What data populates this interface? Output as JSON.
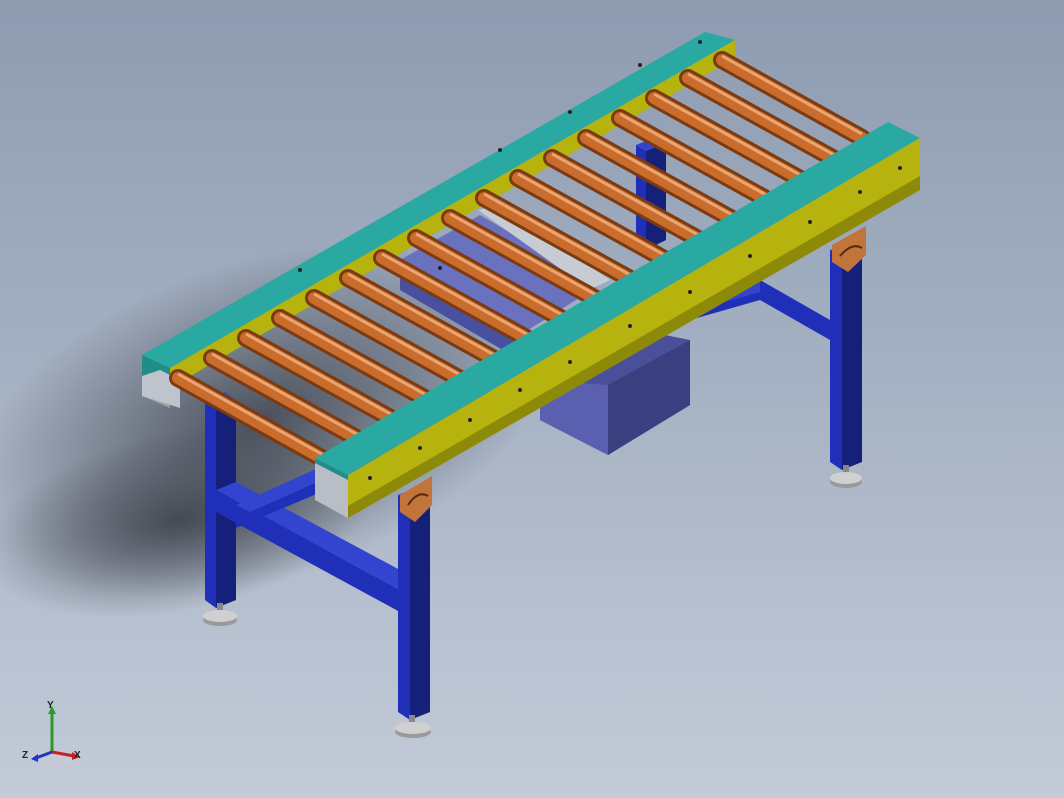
{
  "view": {
    "model_name": "roller conveyor"
  },
  "triad": {
    "x_label": "X",
    "y_label": "Y",
    "z_label": "Z"
  },
  "colors": {
    "frame_blue": "#1f2fb8",
    "roller_orange": "#c96c2c",
    "side_rail_teal": "#2aa8a2",
    "side_rail_yellow": "#b6b30e",
    "motor_box": "#4a4f99",
    "bracket_orange": "#c2753a",
    "foot_grey": "#b8b8b8"
  }
}
